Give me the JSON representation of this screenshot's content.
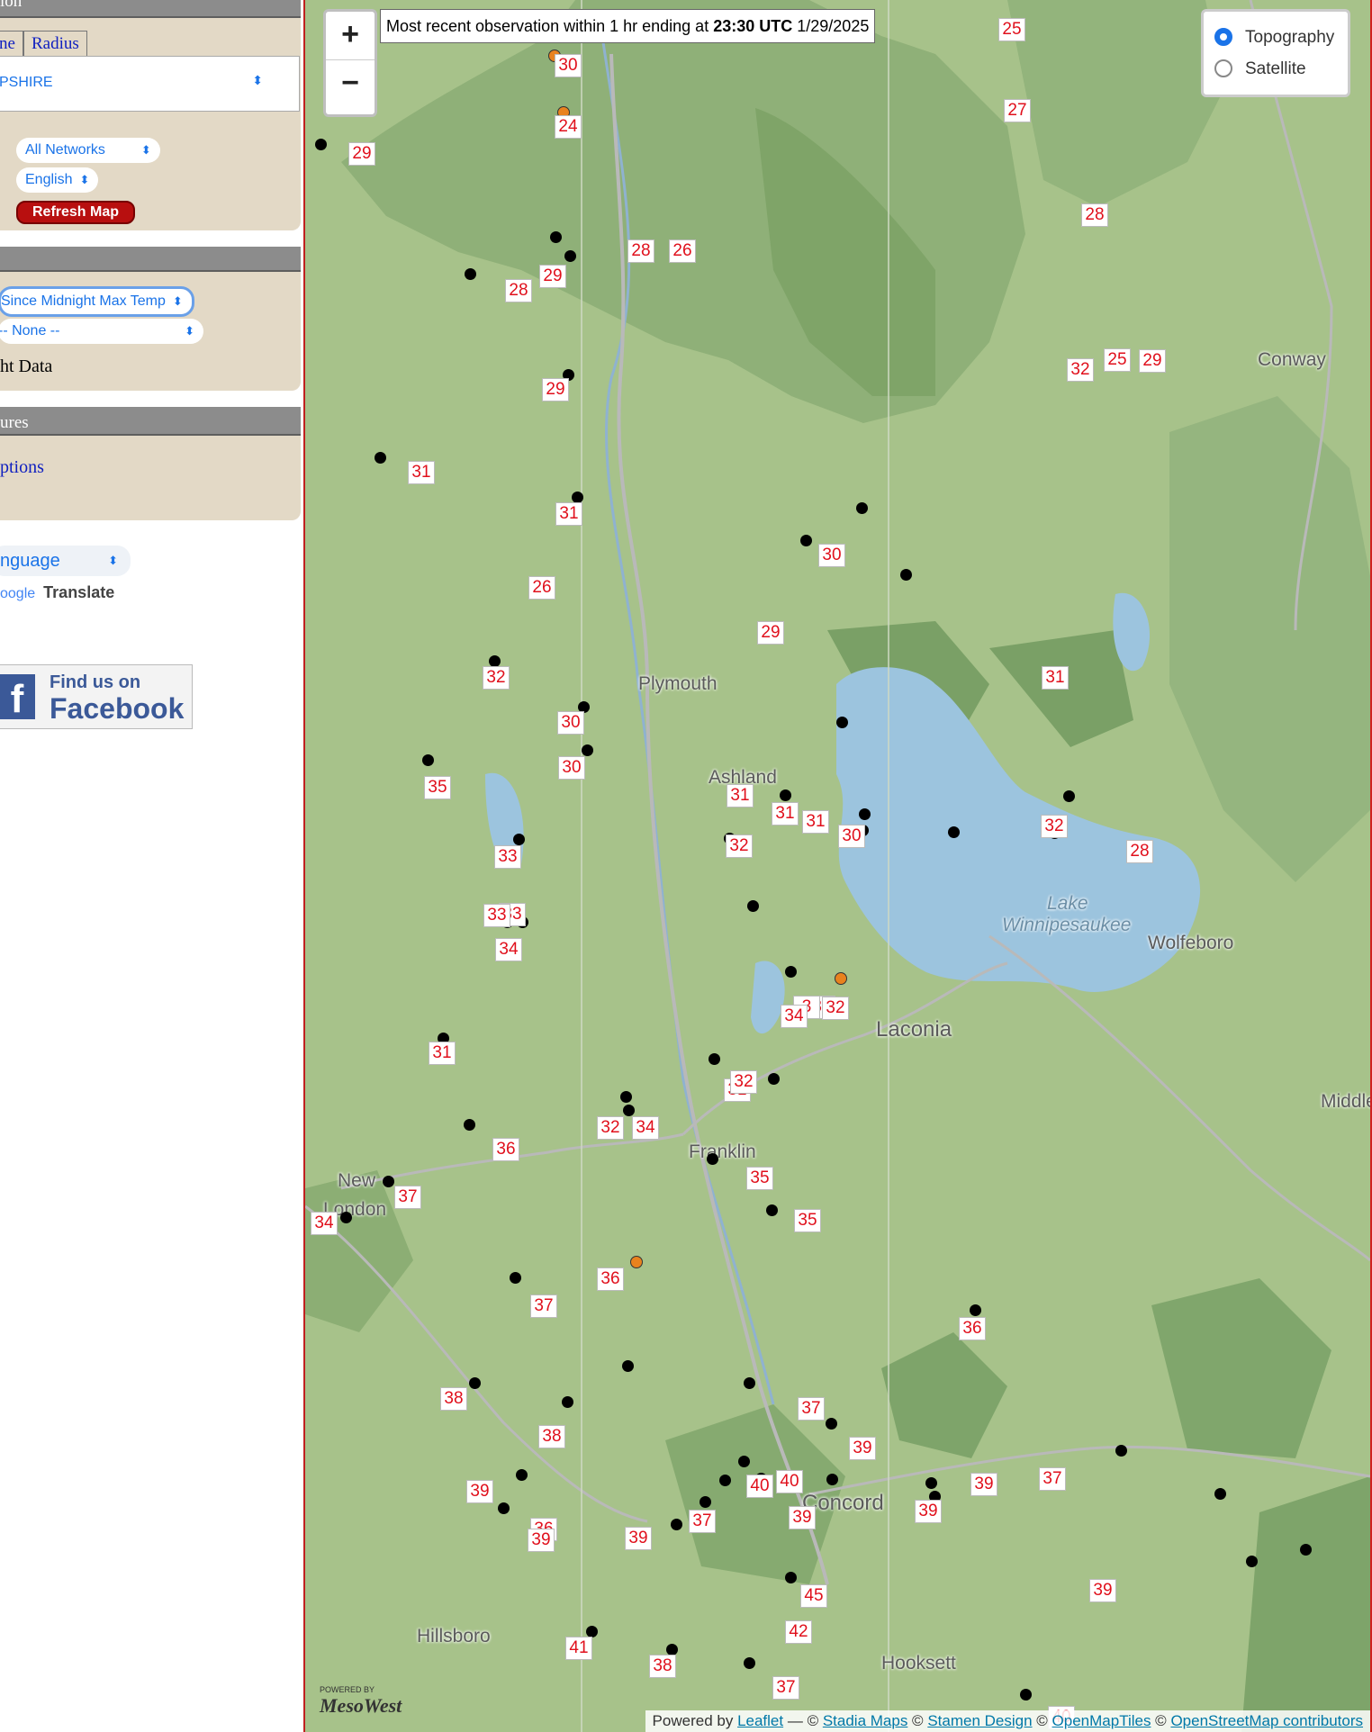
{
  "sidebar": {
    "panel1_title": "ion",
    "tab_left": "ne",
    "tab_radius": "Radius",
    "state_select": "PSHIRE",
    "networks_select": "All Networks",
    "units_select": "English",
    "refresh_button": "Refresh Map",
    "max_temp_select": "Since Midnight Max Temp",
    "none_select": "-- None --",
    "night_data_label": "ht Data",
    "panel3_title": "ures",
    "options_link": "ptions",
    "language_select": "nguage",
    "google_label": "oogle",
    "translate_label": "Translate",
    "facebook_find": "Find us on",
    "facebook_name": "Facebook"
  },
  "map": {
    "zoom_in": "+",
    "zoom_out": "−",
    "obs_prefix": "Most recent observation within 1 hr ending at",
    "obs_time": "23:30 UTC",
    "obs_date": "1/29/2025",
    "layer_topography": "Topography",
    "layer_satellite": "Satellite",
    "attribution": {
      "powered": "Powered by",
      "leaflet": "Leaflet",
      "sep": "— ©",
      "stadia": "Stadia Maps",
      "stamen": "Stamen Design",
      "omt": "OpenMapTiles",
      "osm": "OpenStreetMap contributors"
    },
    "mesowest_powered": "POWERED BY",
    "mesowest": "MesoWest",
    "towns": [
      "Plymouth",
      "Ashland",
      "Lake",
      "Winnipesaukee",
      "Wolfeboro",
      "Laconia",
      "Franklin",
      "New",
      "London",
      "Concord",
      "Hillsboro",
      "Hooksett",
      "Middleto",
      "Conway"
    ],
    "stations": [
      "25",
      "30",
      "27",
      "24",
      "29",
      "28",
      "26",
      "28",
      "29",
      "28",
      "32",
      "25",
      "29",
      "29",
      "31",
      "31",
      "30",
      "26",
      "29",
      "32",
      "31",
      "30",
      "30",
      "35",
      "31",
      "31",
      "32",
      "31",
      "30",
      "28",
      "32",
      "33",
      "33",
      "33",
      "34",
      "31",
      "32",
      "35",
      "3",
      "32",
      "34",
      "31",
      "34",
      "32",
      "36",
      "35",
      "37",
      "34",
      "35",
      "36",
      "37",
      "36",
      "38",
      "38",
      "37",
      "39",
      "39",
      "40",
      "39",
      "40",
      "39",
      "39",
      "36",
      "39",
      "39",
      "37",
      "37",
      "45",
      "39",
      "41",
      "42",
      "38",
      "37",
      "40"
    ]
  }
}
